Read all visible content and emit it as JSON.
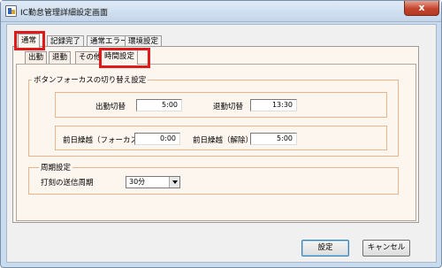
{
  "window": {
    "title": "IC勤怠管理詳細設定画面",
    "close_symbol": "x"
  },
  "tabs": [
    {
      "label": "通常",
      "active": true
    },
    {
      "label": "記録完了",
      "active": false
    },
    {
      "label": "通常エラー",
      "active": false
    },
    {
      "label": "環境設定",
      "active": false
    }
  ],
  "subtabs": [
    {
      "label": "出勤",
      "active": false
    },
    {
      "label": "退勤",
      "active": false
    },
    {
      "label": "その他",
      "active": false
    },
    {
      "label": "時間設定",
      "active": true
    }
  ],
  "focus_group": {
    "legend": "ボタンフォーカスの切り替え設定",
    "checkin_label": "出勤切替",
    "checkin_value": "5:00",
    "checkout_label": "退勤切替",
    "checkout_value": "13:30",
    "prevday_focus_label": "前日繰越（フォーカス）",
    "prevday_focus_value": "0:00",
    "prevday_release_label": "前日繰越（解除）",
    "prevday_release_value": "5:00"
  },
  "period_group": {
    "legend": "周期設定",
    "interval_label": "打刻の送信周期",
    "interval_value": "30分"
  },
  "buttons": {
    "ok": "設定",
    "cancel": "キャンセル"
  },
  "colors": {
    "highlight": "#e01919",
    "group_border": "#e8b48a",
    "panel_bg": "#fdf6ef"
  }
}
